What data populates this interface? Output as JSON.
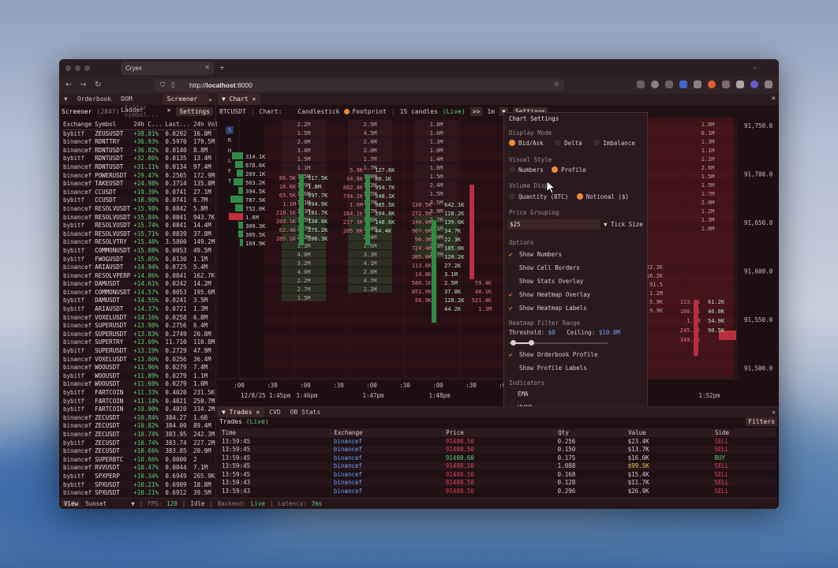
{
  "browser": {
    "tab_title": "Cryex",
    "url_host": "localhost",
    "url_port": ":8000",
    "url_prefix": "http://"
  },
  "left_panel": {
    "tabs": [
      {
        "label": "Orderbook"
      },
      {
        "label": "DOM Ladder"
      },
      {
        "label": "Screener",
        "active": true
      }
    ],
    "title": "Screener",
    "count": "(2847)",
    "filter_placeholder": "Filter symbol...",
    "settings_label": "Settings",
    "columns": [
      "Exchange",
      "Symbol",
      "24h C...",
      "Last...",
      "24h Volu..."
    ],
    "rows": [
      [
        "bybitf",
        "ZEUSUSDT",
        "+38.81%",
        "0.0292",
        "16.0M"
      ],
      [
        "binancef",
        "RDNTTRY",
        "+36.93%",
        "0.5970",
        "179.5M"
      ],
      [
        "binancef",
        "RDNTUSDT",
        "+36.82%",
        "0.0140",
        "8.8M"
      ],
      [
        "bybitf",
        "RDNTUSDT",
        "+32.06%",
        "0.0135",
        "13.4M"
      ],
      [
        "binancef",
        "RDNTUSDT",
        "+31.11%",
        "0.0134",
        "97.4M"
      ],
      [
        "binancef",
        "POWERUSDT",
        "+29.47%",
        "0.2565",
        "172.9M"
      ],
      [
        "binancef",
        "TAKEUSDT",
        "+24.98%",
        "0.3714",
        "135.8M"
      ],
      [
        "binancef",
        "CCUSDT",
        "+19.39%",
        "0.0741",
        "27.1M"
      ],
      [
        "bybitf",
        "CCUSDT",
        "+18.90%",
        "0.0741",
        "6.7M"
      ],
      [
        "binancef",
        "RESOLVUSDT",
        "+15.98%",
        "0.0842",
        "5.8M"
      ],
      [
        "binancef",
        "RESOLVUSDT",
        "+15.84%",
        "0.0841",
        "943.7K"
      ],
      [
        "bybitf",
        "RESOLVUSDT",
        "+15.74%",
        "0.0841",
        "14.4M"
      ],
      [
        "binancef",
        "RESOLVUSDT",
        "+15.71%",
        "0.0839",
        "37.8M"
      ],
      [
        "binancef",
        "RESOLVTRY",
        "+15.48%",
        "3.5800",
        "149.2M"
      ],
      [
        "bybitf",
        "COMMONUSDT",
        "+15.08%",
        "0.0053",
        "49.5M"
      ],
      [
        "bybitf",
        "FWOGUSDT",
        "+15.05%",
        "0.0130",
        "1.1M"
      ],
      [
        "binancef",
        "ARIAUSDT",
        "+14.94%",
        "0.0725",
        "5.4M"
      ],
      [
        "binancef",
        "RESOLVPERP",
        "+14.86%",
        "0.0841",
        "162.7K"
      ],
      [
        "binancef",
        "DAMUSDT",
        "+14.61%",
        "0.0242",
        "14.2M"
      ],
      [
        "binancef",
        "COMMONUSDT",
        "+14.57%",
        "0.0053",
        "195.6M"
      ],
      [
        "bybitf",
        "DAMUSDT",
        "+14.55%",
        "0.0241",
        "3.5M"
      ],
      [
        "bybitf",
        "ARIAUSDT",
        "+14.37%",
        "0.0721",
        "1.3M"
      ],
      [
        "binancef",
        "VOXELUSDT",
        "+14.16%",
        "0.0258",
        "6.8M"
      ],
      [
        "binancef",
        "SUPERUSDT",
        "+13.98%",
        "0.2756",
        "6.4M"
      ],
      [
        "binancef",
        "SUPERUSDT",
        "+13.83%",
        "0.2749",
        "20.8M"
      ],
      [
        "binancef",
        "SUPERTRY",
        "+13.69%",
        "11.710",
        "110.8M"
      ],
      [
        "bybitf",
        "SUPERUSDT",
        "+13.19%",
        "0.2729",
        "47.9M"
      ],
      [
        "binancef",
        "VOXELUSDT",
        "+13.00%",
        "0.0256",
        "36.4M"
      ],
      [
        "binancef",
        "WOOUSDT",
        "+11.96%",
        "0.0279",
        "7.4M"
      ],
      [
        "bybitf",
        "WOOUSDT",
        "+11.89%",
        "0.0279",
        "1.1M"
      ],
      [
        "binancef",
        "WOOUSDT",
        "+11.60%",
        "0.0279",
        "1.0M"
      ],
      [
        "bybitf",
        "FARTCOIN",
        "+11.33%",
        "0.4020",
        "231.5K"
      ],
      [
        "bybitf",
        "FARTCOIN",
        "+11.14%",
        "0.4021",
        "258.7M"
      ],
      [
        "bybitf",
        "FARTCOIN",
        "+10.90%",
        "0.4020",
        "334.2M"
      ],
      [
        "binancef",
        "ZECUSDT",
        "+10.84%",
        "384.27",
        "1.6B"
      ],
      [
        "binancef",
        "ZECUSDT",
        "+10.82%",
        "384.00",
        "89.4M"
      ],
      [
        "binancef",
        "ZECUSDT",
        "+10.74%",
        "383.95",
        "242.3M"
      ],
      [
        "bybitf",
        "ZECUSDT",
        "+10.74%",
        "383.74",
        "227.2M"
      ],
      [
        "binancef",
        "ZECUSDT",
        "+10.66%",
        "383.85",
        "20.9M"
      ],
      [
        "binancef",
        "SUPERBTC",
        "+10.66%",
        "0.0000",
        "2"
      ],
      [
        "binancef",
        "RVVUSDT",
        "+10.47%",
        "0.0044",
        "7.1M"
      ],
      [
        "bybitf",
        "SPXPERP",
        "+10.34%",
        "0.6949",
        "265.9K"
      ],
      [
        "bybitf",
        "SPXUSDT",
        "+10.21%",
        "0.6909",
        "18.8M"
      ],
      [
        "binancef",
        "SPXUSDT",
        "+10.21%",
        "0.6912",
        "39.5M"
      ]
    ]
  },
  "footer": {
    "view": "View",
    "theme": "Sunset",
    "fps_label": "FPS:",
    "fps": "120",
    "state": "Idle",
    "backend_label": "Backend:",
    "backend": "Live",
    "latency_label": "Latency:",
    "latency": "7ms"
  },
  "chart": {
    "tab": "Chart",
    "symbol": "BTCUSDT",
    "chart_label": "Chart:",
    "mode1": "Candlestick",
    "mode2": "Footprint",
    "candles": "15 candles",
    "live": "(Live)",
    "arrows": ">>",
    "interval": "1m",
    "settings": "Settings",
    "side_buttons": [
      "S",
      "R",
      "H",
      "L",
      "F",
      "T"
    ],
    "price_axis": [
      "91,750.0",
      "91,700.0",
      "91,650.0",
      "91,600.0",
      "91,550.0",
      "91,500.0"
    ],
    "time_axis": [
      ":00",
      ":30",
      ":00",
      ":30",
      ":00",
      ":30",
      ":00",
      ":30",
      ":00",
      ":30",
      ":00"
    ],
    "time_labels": [
      "12/8/25 1:45pm",
      "1:46pm",
      "1:47pm",
      "1:48pm",
      "1:52pm"
    ],
    "profile_left": [
      "314.1K",
      "678.6K",
      "269.1K",
      "563.2K",
      "394.5K",
      "787.5K",
      "752.0K",
      "1.6M",
      "309.3K",
      "309.5K",
      "169.9K"
    ],
    "col_a": [
      "86.5K",
      "16.6K",
      "65.5K",
      "1.1M",
      "218.1K",
      "203.1K",
      "62.4K",
      "285.1K"
    ],
    "col_b": [
      "517.5K",
      "1.8M",
      "997.7K",
      "994.9K",
      "181.7K",
      "130.6K",
      "275.2K",
      "206.3K"
    ],
    "col_c": [
      "5.9K",
      "34.8K",
      "882.4K",
      "734.2K",
      "1.0M",
      "164.1K",
      "217.3K",
      "205.8K"
    ],
    "col_d": [
      "127.6K",
      "80.1K",
      "954.7K",
      "548.1K",
      "985.5K",
      "394.8K",
      "148.6K",
      "44.4K"
    ],
    "vol_cols": [
      [
        "2.2M",
        "1.5M",
        "2.0M",
        "3.8M",
        "1.5M",
        "1.1M",
        "1.5M",
        "1.9M",
        "1.6M",
        "1.1M",
        "1.3M",
        "1.5M",
        "2.7M",
        "2.3M",
        "1.3M",
        "4.0M",
        "3.2M",
        "4.0M",
        "2.2M",
        "2.7M",
        "1.5M"
      ],
      [
        "2.5M",
        "4.5M",
        "2.4M",
        "2.0M",
        "1.7M",
        "1.7M",
        "1.8M",
        "1.3M",
        "1.5M",
        "1.7M",
        "1.7M",
        "1.6M",
        "1.4M",
        "2.4M",
        "2.6M",
        "3.3M",
        "4.1M",
        "2.6M",
        "4.7M",
        "2.2M"
      ],
      [
        "1.8M",
        "1.6M",
        "1.3M",
        "1.0M",
        "1.4M",
        "1.8M",
        "1.5M",
        "2.4M",
        "1.5M",
        "3.5M",
        "3.9M",
        "2.7M",
        "3.1M",
        "3.0M",
        "2.3M",
        "1.7M"
      ]
    ],
    "col_e": [
      "138.5K",
      "272.5K",
      "140.0K",
      "907.0K",
      "96.3K",
      "724.4K",
      "385.0K",
      "113.6K",
      "14.8K",
      "580.1K",
      "851.9K",
      "56.9K"
    ],
    "col_f": [
      "642.1K",
      "128.2K",
      "139.0K",
      "34.7K",
      "22.3K",
      "185.0K",
      "120.2K",
      "27.2K",
      "3.1M",
      "2.5M",
      "37.8K",
      "128.2K",
      "44.2K"
    ],
    "col_g": [
      "59.4K",
      "48.1K",
      "521.4K",
      "1.3M"
    ],
    "right_vol": [
      "1.8M",
      "6.1M",
      "1.3M",
      "1.1M",
      "1.1M",
      "2.6M",
      "1.5M",
      "1.5M",
      "1.7M",
      "2.0M",
      "1.2M",
      "1.3M",
      "1.8M"
    ],
    "right_nums": [
      "22.2K",
      "16.2K",
      "91.5",
      "1.2M",
      "5.9K",
      "9.9K"
    ],
    "right_b": [
      "113.4K",
      "100.3K",
      "1.3M",
      "245.8K",
      "349.6K"
    ],
    "right_c": [
      "61.2K",
      "46.0K",
      "54.9K",
      "90.5K"
    ]
  },
  "settings": {
    "title": "Chart Settings",
    "display_mode": "Display Mode",
    "modes": [
      "Bid/Ask",
      "Delta",
      "Imbalance"
    ],
    "visual_style": "Visual Style",
    "styles": [
      "Numbers",
      "Profile"
    ],
    "volume_display": "Volume Displ",
    "volumes": [
      "Quantity (BTC)",
      "Notional ($)"
    ],
    "price_grouping": "Price Grouping",
    "grouping_value": "$25",
    "tick_size": "Tick Size",
    "options": "Options",
    "opts": [
      [
        "Show Numbers",
        true
      ],
      [
        "Show Cell Borders",
        false
      ],
      [
        "Show Stats Overlay",
        false
      ],
      [
        "Show Heatmap Overlay",
        true
      ],
      [
        "Show Heatmap Labels",
        true
      ]
    ],
    "heatmap_filter": "Heatmap Filter Range",
    "threshold_label": "Threshold:",
    "threshold": "$0",
    "ceiling_label": "Ceiling:",
    "ceiling": "$10.0M",
    "slider_start": 0.04,
    "slider_end": 0.22,
    "opts2": [
      [
        "Show Orderbook Profile",
        true
      ],
      [
        "Show Profile Labels",
        false
      ]
    ],
    "indicators": "Indicators",
    "inds": [
      "EMA",
      "VWAP"
    ]
  },
  "trades": {
    "tabs": [
      "Trades",
      "CVD",
      "OB Stats"
    ],
    "title": "Trades",
    "live": "(Live)",
    "filters": "Filters",
    "columns": [
      "Time",
      "Exchange",
      "Price",
      "Qty",
      "Value",
      "Side"
    ],
    "rows": [
      [
        "13:59:45",
        "binancef",
        "91408.50",
        "0.256",
        "$23.4K",
        "SELL"
      ],
      [
        "13:59:45",
        "binancef",
        "91408.50",
        "0.150",
        "$13.7K",
        "SELL"
      ],
      [
        "13:59:45",
        "binancef",
        "91408.60",
        "0.175",
        "$16.0K",
        "BUY"
      ],
      [
        "13:59:45",
        "binancef",
        "91408.50",
        "1.088",
        "$99.5K",
        "SELL"
      ],
      [
        "13:59:45",
        "binancef",
        "91408.50",
        "0.168",
        "$15.4K",
        "SELL"
      ],
      [
        "13:59:43",
        "binancef",
        "91408.50",
        "0.128",
        "$11.7K",
        "SELL"
      ],
      [
        "13:59:43",
        "binancef",
        "91408.50",
        "0.296",
        "$26.9K",
        "SELL"
      ]
    ]
  },
  "colors": {
    "sell": "#e0455a",
    "buy": "#5fd07a",
    "accent": "#f08a3c",
    "value_hi": "#e8c24a"
  }
}
